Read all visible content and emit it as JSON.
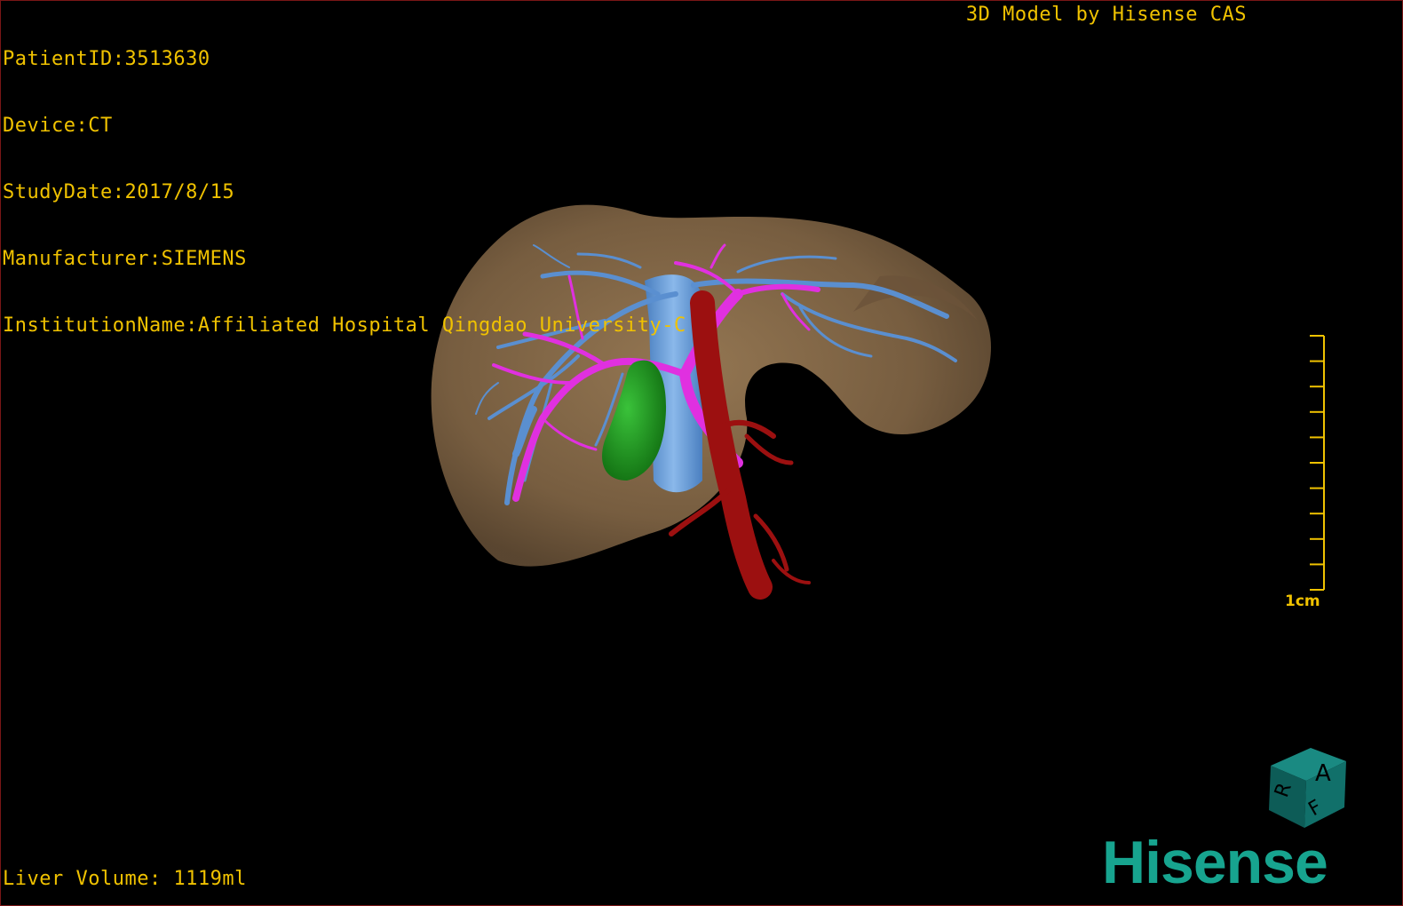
{
  "overlay": {
    "patient_id": "PatientID:3513630",
    "device": "Device:CT",
    "study_date": "StudyDate:2017/8/15",
    "manufacturer": "Manufacturer:SIEMENS",
    "institution": "InstitutionName:Affiliated Hospital Qingdao University-C",
    "model_title": "3D Model by Hisense CAS",
    "liver_volume": "Liver Volume: 1119ml"
  },
  "scale_bar": {
    "label": "1cm",
    "tick_count": 11
  },
  "orientation_cube": {
    "top_letter": "A",
    "left_letter": "R",
    "front_letter": "F"
  },
  "branding": {
    "logo_text": "Hisense"
  },
  "colors": {
    "overlay_text": "#f0c200",
    "liver": "#8a6c4a",
    "hepatic_vein": "#5a8fd0",
    "portal_vein": "#e030e0",
    "artery_ivc": "#9c1010",
    "gallbladder": "#1e9a1e",
    "brand": "#17a48f",
    "cube": "#11706a"
  }
}
